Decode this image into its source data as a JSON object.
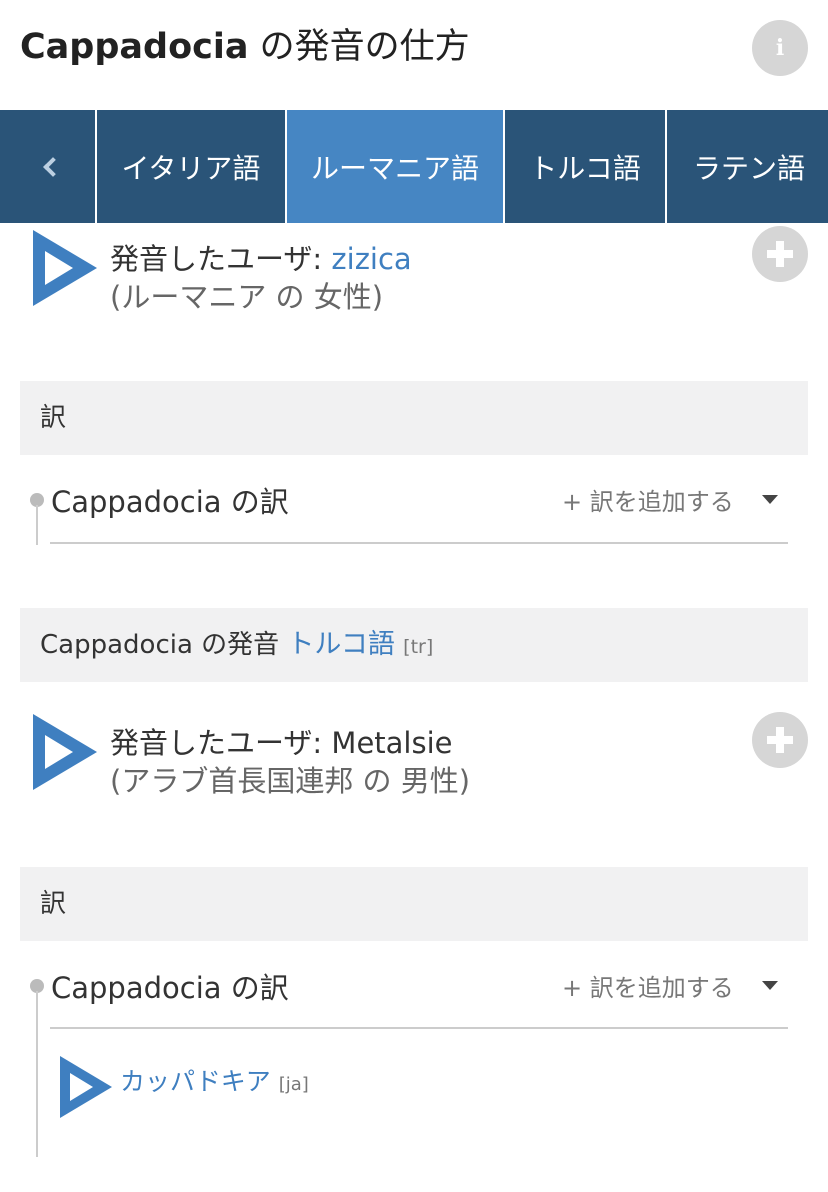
{
  "header": {
    "title_word": "Cappadocia",
    "title_rest": " の発音の仕方",
    "info_icon": "i"
  },
  "tabs": [
    {
      "label": "イタリア語",
      "active": false
    },
    {
      "label": "ルーマニア語",
      "active": true
    },
    {
      "label": "トルコ語",
      "active": false
    },
    {
      "label": "ラテン語",
      "active": false
    }
  ],
  "recordings": [
    {
      "prefix": "発音したユーザ: ",
      "username": "zizica",
      "origin": "(ルーマニア の 女性)"
    },
    {
      "prefix": "発音したユーザ: ",
      "username": "Metalsie",
      "origin": "(アラブ首長国連邦 の 男性)"
    }
  ],
  "translation_sections": [
    {
      "header": "訳",
      "title": "Cappadocia の訳",
      "add_label": "+ 訳を追加する",
      "items": []
    },
    {
      "header": "訳",
      "title": "Cappadocia の訳",
      "add_label": "+ 訳を追加する",
      "items": [
        {
          "word": "カッパドキア",
          "code": "[ja]"
        }
      ]
    }
  ],
  "language_section": {
    "prefix": "Cappadocia の発音 ",
    "language": "トルコ語",
    "code": "[tr]"
  },
  "colors": {
    "tab_bg": "#2a5478",
    "tab_active": "#4686c3",
    "accent": "#3f7fc0",
    "button_grey": "#d6d6d6"
  }
}
